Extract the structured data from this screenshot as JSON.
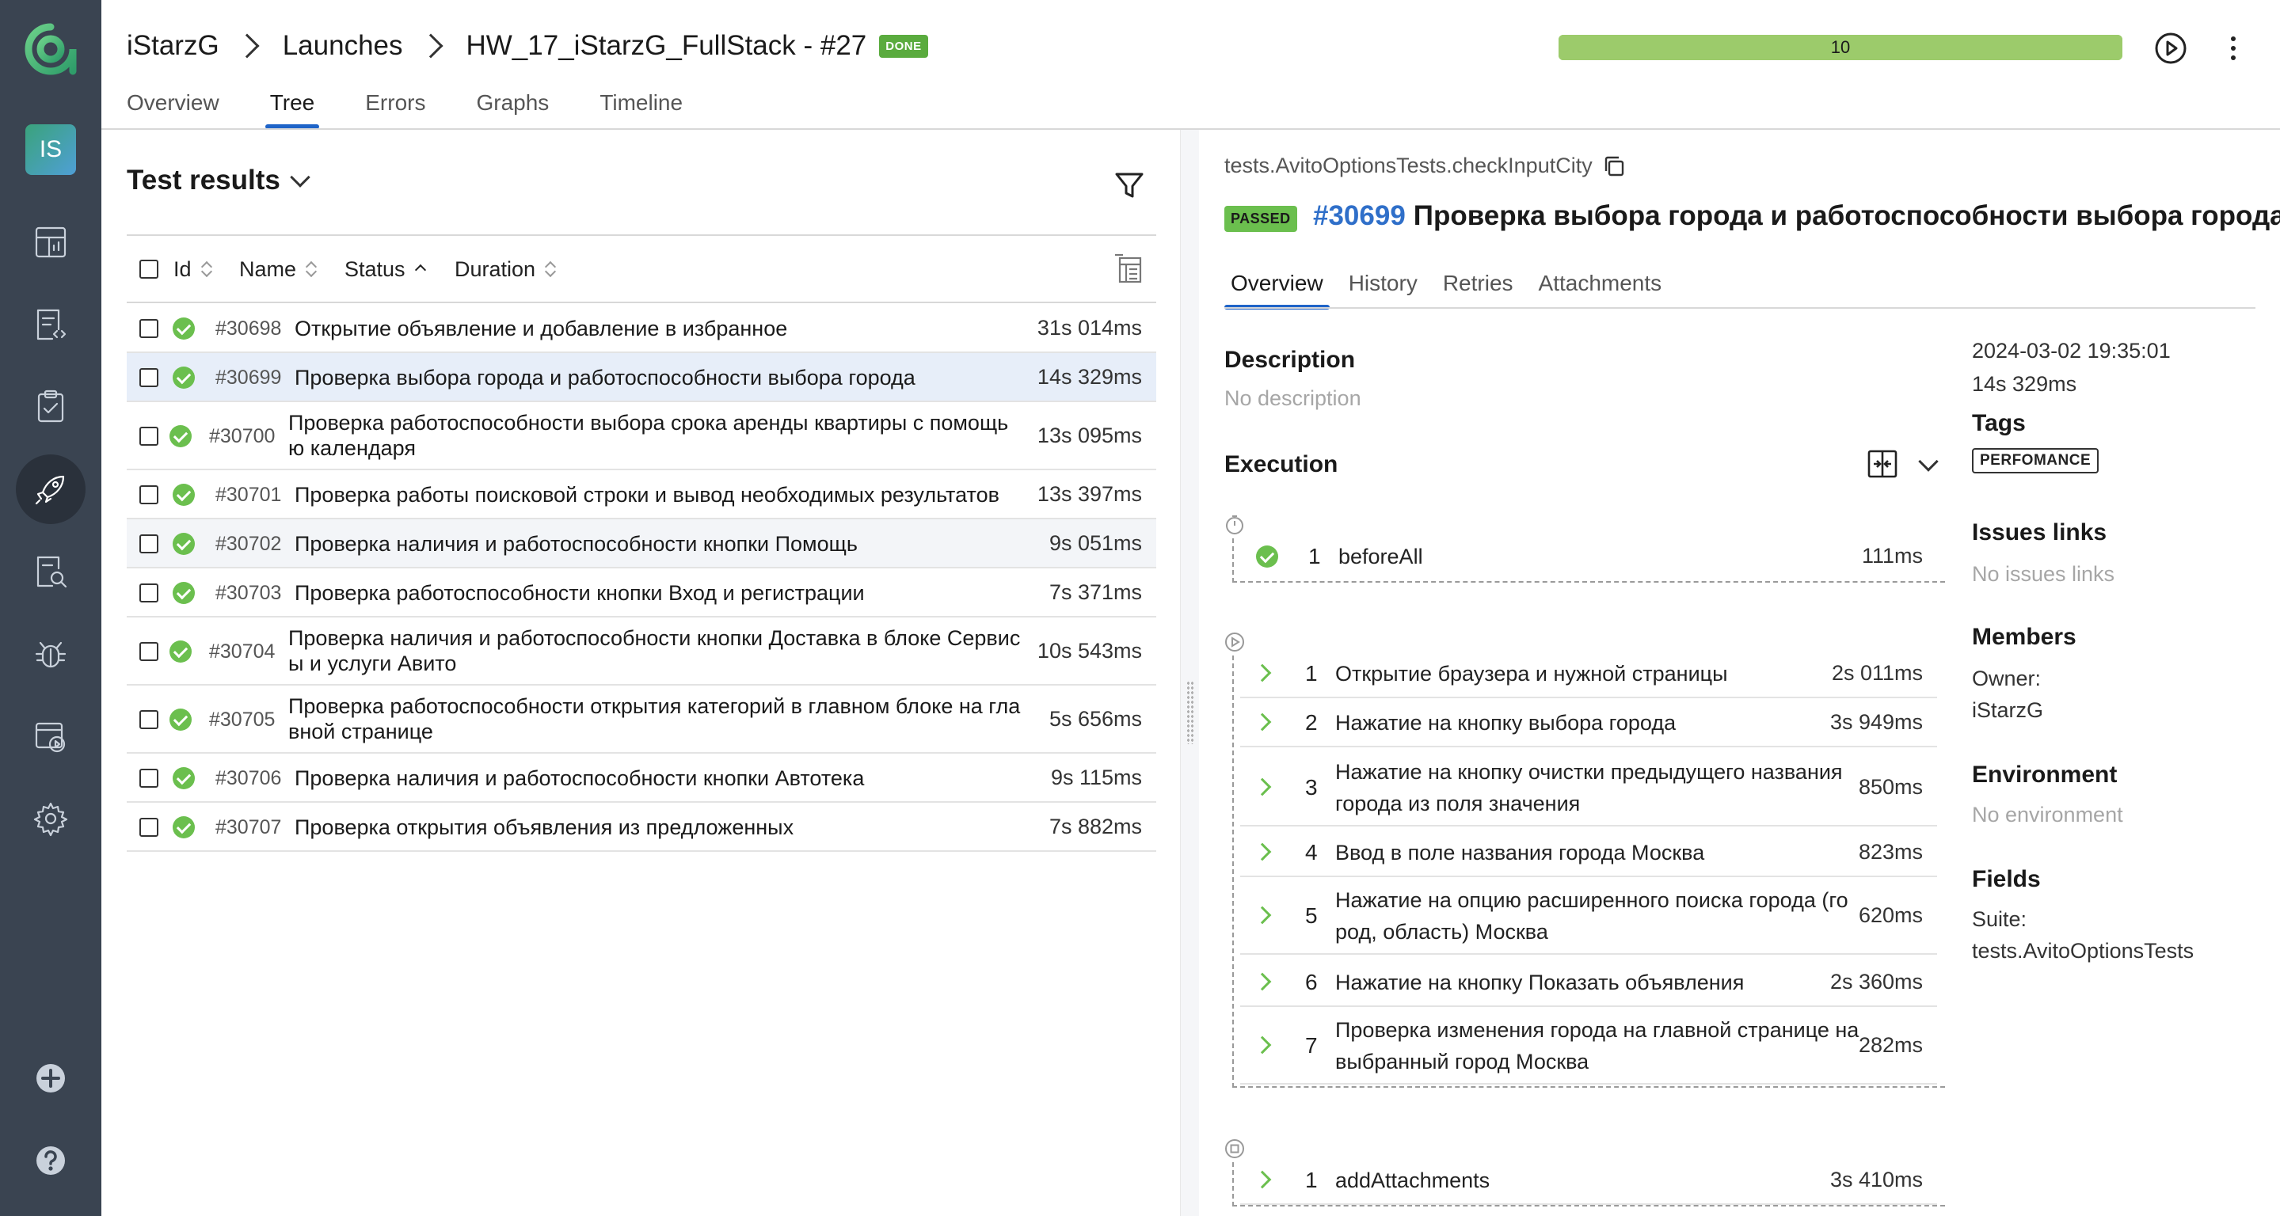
{
  "breadcrumb": {
    "project": "iStarzG",
    "section": "Launches",
    "launch": "HW_17_iStarzG_FullStack - #27",
    "status_badge": "DONE"
  },
  "progress": {
    "value": "10",
    "fraction": 1.0,
    "color": "#9ccb6b"
  },
  "sidebar": {
    "avatar_initials": "IS"
  },
  "top_tabs": [
    "Overview",
    "Tree",
    "Errors",
    "Graphs",
    "Timeline"
  ],
  "active_top_tab": "Tree",
  "test_results": {
    "title": "Test results",
    "columns": {
      "id": "Id",
      "name": "Name",
      "status": "Status",
      "duration": "Duration"
    },
    "rows": [
      {
        "id": "#30698",
        "name": "Открытие объявление и добавление в избранное",
        "duration": "31s 014ms",
        "status": "passed"
      },
      {
        "id": "#30699",
        "name": "Проверка выбора города и работоспособности выбора города",
        "duration": "14s 329ms",
        "status": "passed"
      },
      {
        "id": "#30700",
        "name": "Проверка работоспособности выбора срока аренды квартиры с помощь\nю календаря",
        "duration": "13s 095ms",
        "status": "passed"
      },
      {
        "id": "#30701",
        "name": "Проверка работы поисковой строки и вывод необходимых результатов",
        "duration": "13s 397ms",
        "status": "passed"
      },
      {
        "id": "#30702",
        "name": "Проверка наличия и работоспособности кнопки Помощь",
        "duration": "9s 051ms",
        "status": "passed"
      },
      {
        "id": "#30703",
        "name": "Проверка работоспособности кнопки Вход и регистрации",
        "duration": "7s 371ms",
        "status": "passed"
      },
      {
        "id": "#30704",
        "name": "Проверка наличия и работоспособности кнопки Доставка в блоке Сервис\nы и услуги Авито",
        "duration": "10s 543ms",
        "status": "passed"
      },
      {
        "id": "#30705",
        "name": "Проверка работоспособности открытия категорий в главном блоке на гла\nвной странице",
        "duration": "5s 656ms",
        "status": "passed"
      },
      {
        "id": "#30706",
        "name": "Проверка наличия и работоспособности кнопки Автотека",
        "duration": "9s 115ms",
        "status": "passed"
      },
      {
        "id": "#30707",
        "name": "Проверка открытия объявления из предложенных",
        "duration": "7s 882ms",
        "status": "passed"
      }
    ]
  },
  "test_case": {
    "path": "tests.AvitoOptionsTests.checkInputCity",
    "status_badge": "PASSED",
    "id": "#30699",
    "title": "Проверка выбора города и работоспособности выбора города",
    "tabs": [
      "Overview",
      "History",
      "Retries",
      "Attachments"
    ],
    "description_title": "Description",
    "description": "No description",
    "execution_title": "Execution",
    "before": [
      {
        "num": "1",
        "name": "beforeAll",
        "duration": "111ms"
      }
    ],
    "steps": [
      {
        "num": "1",
        "name": "Открытие браузера и нужной страницы",
        "duration": "2s 011ms"
      },
      {
        "num": "2",
        "name": "Нажатие на кнопку выбора города",
        "duration": "3s 949ms"
      },
      {
        "num": "3",
        "name": "Нажатие на кнопку очистки предыдущего названия\nгорода из поля значения",
        "duration": "850ms"
      },
      {
        "num": "4",
        "name": "Ввод в поле названия города Москва",
        "duration": "823ms"
      },
      {
        "num": "5",
        "name": "Нажатие на опцию расширенного поиска города (го\nрод, область) Москва",
        "duration": "620ms"
      },
      {
        "num": "6",
        "name": "Нажатие на кнопку Показать объявления",
        "duration": "2s 360ms"
      },
      {
        "num": "7",
        "name": "Проверка изменения города на главной странице на\nвыбранный город Москва",
        "duration": "282ms"
      }
    ],
    "after": [
      {
        "num": "1",
        "name": "addAttachments",
        "duration": "3s 410ms"
      }
    ]
  },
  "meta": {
    "date": "2024-03-02 19:35:01",
    "duration": "14s 329ms",
    "tags_title": "Tags",
    "tag": "PERFOMANCE",
    "issues_title": "Issues links",
    "issues": "No issues links",
    "members_title": "Members",
    "owner_label": "Owner:",
    "owner": "iStarzG",
    "environment_title": "Environment",
    "environment": "No environment",
    "fields_title": "Fields",
    "suite_label": "Suite:",
    "suite": "tests.AvitoOptionsTests"
  },
  "colors": {
    "sidebar": "#3a4451",
    "passed": "#6bbf4e",
    "accent": "#1f64c8",
    "link": "#2f6fc9"
  }
}
